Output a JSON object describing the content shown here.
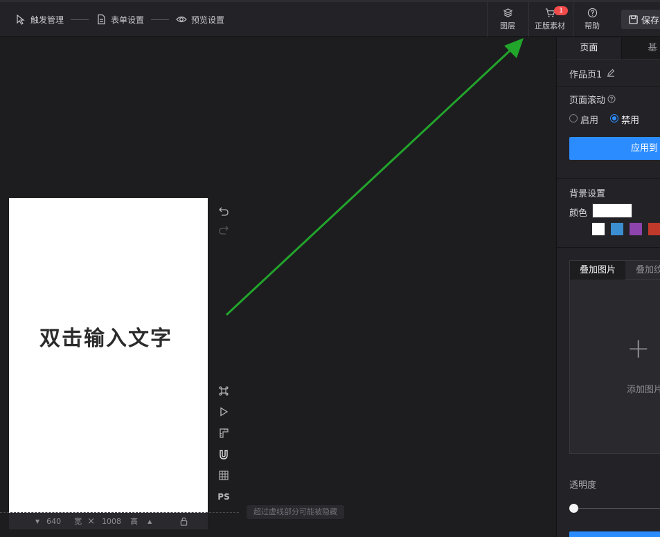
{
  "topbar": {
    "steps": [
      {
        "icon": "trigger-icon",
        "label": "触发管理"
      },
      {
        "icon": "form-icon",
        "label": "表单设置"
      },
      {
        "icon": "eye-icon",
        "label": "预览设置"
      }
    ],
    "tools": {
      "layers": "图层",
      "assets": "正版素材",
      "assets_badge": "1",
      "help": "帮助"
    },
    "save_label": "保存"
  },
  "canvas": {
    "placeholder_text": "双击输入文字",
    "width": "640",
    "width_label": "宽",
    "times": "×",
    "height": "1008",
    "height_label": "高",
    "hint": "超过虚线部分可能被隐藏",
    "ps_label": "PS"
  },
  "panel": {
    "tab_page": "页面",
    "tab_other": "基",
    "page_name": "作品页1",
    "scroll_label": "页面滚动",
    "radio_enable": "启用",
    "radio_disable": "禁用",
    "apply_label": "应用到",
    "bg_label": "背景设置",
    "color_label": "颜色",
    "swatches": [
      "#ffffff",
      "#3b8fd0",
      "#8e44ad",
      "#c0392b"
    ],
    "overlay_tab_image": "叠加图片",
    "overlay_tab_texture": "叠加纹",
    "add_image": "添加图片",
    "opacity_label": "透明度"
  },
  "colors": {
    "accent": "#2b8cff",
    "arrow": "#22a52b",
    "badge": "#f04a4a"
  }
}
